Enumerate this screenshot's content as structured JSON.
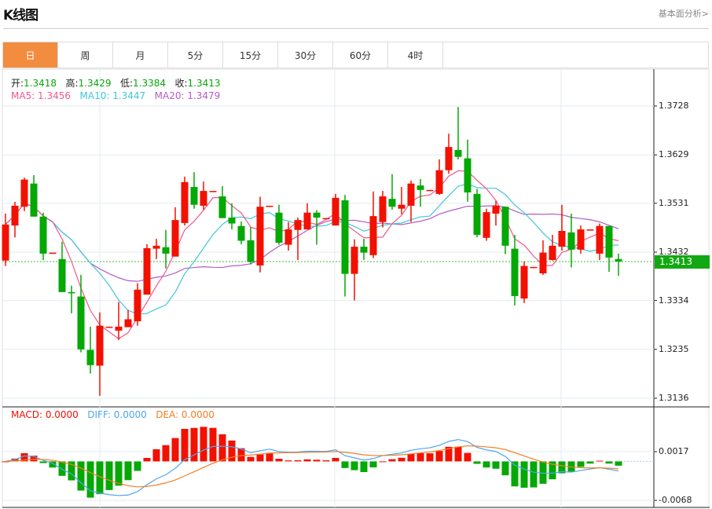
{
  "header": {
    "title": "K线图",
    "more_link": "基本面分析>"
  },
  "tabs": [
    {
      "label": "日",
      "active": true
    },
    {
      "label": "周"
    },
    {
      "label": "月"
    },
    {
      "label": "5分"
    },
    {
      "label": "15分"
    },
    {
      "label": "30分"
    },
    {
      "label": "60分"
    },
    {
      "label": "4时"
    }
  ],
  "ohlc_info": {
    "open_label": "开:",
    "open": "1.3418",
    "high_label": "高:",
    "high": "1.3429",
    "low_label": "低:",
    "low": "1.3384",
    "close_label": "收:",
    "close": "1.3413"
  },
  "ma_info": {
    "ma5": "MA5: 1.3456",
    "ma10": "MA10: 1.3447",
    "ma20": "MA20: 1.3479"
  },
  "macd_info": {
    "macd": "MACD: 0.0000",
    "diff": "DIFF: 0.0000",
    "dea": "DEA: 0.0000"
  },
  "current_price": "1.3413",
  "colors": {
    "up": "#f21100",
    "down": "#05a805",
    "ma5": "#f0588a",
    "ma10": "#3fc6dc",
    "ma20": "#b45cc8",
    "diff": "#4da6f0",
    "dea": "#f57e22",
    "accent": "#f28c3e"
  },
  "chart_data": {
    "type": "candlestick",
    "y_ticks": [
      "1.3728",
      "1.3629",
      "1.3531",
      "1.3432",
      "1.3334",
      "1.3235",
      "1.3136"
    ],
    "ylim": [
      1.3136,
      1.3728
    ],
    "macd_ticks": [
      "0.0017",
      "-0.0068"
    ],
    "macd_ylim": [
      -0.0068,
      0.0017
    ],
    "candles": [
      [
        1.3415,
        1.351,
        1.3404,
        1.3488
      ],
      [
        1.3486,
        1.3534,
        1.3462,
        1.3526
      ],
      [
        1.3524,
        1.3583,
        1.3515,
        1.3579
      ],
      [
        1.3571,
        1.3588,
        1.3504,
        1.3504
      ],
      [
        1.3504,
        1.3512,
        1.3416,
        1.3429
      ],
      [
        1.343,
        1.3431,
        1.343,
        1.3431
      ],
      [
        1.3418,
        1.3453,
        1.3351,
        1.3351
      ],
      [
        1.3351,
        1.3364,
        1.3308,
        1.335
      ],
      [
        1.3342,
        1.3386,
        1.3229,
        1.3235
      ],
      [
        1.3234,
        1.3281,
        1.3186,
        1.3203
      ],
      [
        1.3202,
        1.331,
        1.3141,
        1.3283
      ],
      [
        1.328,
        1.3281,
        1.328,
        1.3281
      ],
      [
        1.3273,
        1.3331,
        1.3254,
        1.3281
      ],
      [
        1.328,
        1.3315,
        1.328,
        1.3296
      ],
      [
        1.3292,
        1.3369,
        1.3283,
        1.3356
      ],
      [
        1.3346,
        1.3448,
        1.3346,
        1.344
      ],
      [
        1.3439,
        1.3459,
        1.3418,
        1.3445
      ],
      [
        1.3442,
        1.3477,
        1.3399,
        1.3429
      ],
      [
        1.3423,
        1.3523,
        1.3423,
        1.3497
      ],
      [
        1.3491,
        1.3585,
        1.3486,
        1.3574
      ],
      [
        1.3564,
        1.3594,
        1.352,
        1.3528
      ],
      [
        1.3526,
        1.3575,
        1.3518,
        1.3556
      ],
      [
        1.3555,
        1.3556,
        1.3555,
        1.3556
      ],
      [
        1.3545,
        1.3566,
        1.3501,
        1.3501
      ],
      [
        1.3502,
        1.3531,
        1.3478,
        1.349
      ],
      [
        1.3485,
        1.3494,
        1.3448,
        1.3455
      ],
      [
        1.3456,
        1.3483,
        1.3407,
        1.3412
      ],
      [
        1.3405,
        1.3544,
        1.3391,
        1.3524
      ],
      [
        1.3525,
        1.3526,
        1.3525,
        1.3526
      ],
      [
        1.3512,
        1.3528,
        1.3447,
        1.3451
      ],
      [
        1.3447,
        1.3493,
        1.3435,
        1.3478
      ],
      [
        1.3477,
        1.3502,
        1.3416,
        1.3497
      ],
      [
        1.3478,
        1.3531,
        1.3478,
        1.3512
      ],
      [
        1.3512,
        1.3517,
        1.3447,
        1.3502
      ],
      [
        1.35,
        1.3501,
        1.35,
        1.3501
      ],
      [
        1.3486,
        1.355,
        1.3486,
        1.3542
      ],
      [
        1.3537,
        1.3548,
        1.3342,
        1.3388
      ],
      [
        1.3388,
        1.3458,
        1.3334,
        1.3443
      ],
      [
        1.3443,
        1.3459,
        1.3416,
        1.3431
      ],
      [
        1.3426,
        1.3555,
        1.342,
        1.3505
      ],
      [
        1.3493,
        1.3556,
        1.3482,
        1.3545
      ],
      [
        1.354,
        1.359,
        1.3518,
        1.3524
      ],
      [
        1.352,
        1.3564,
        1.3509,
        1.3528
      ],
      [
        1.3526,
        1.3577,
        1.3493,
        1.3571
      ],
      [
        1.3567,
        1.358,
        1.3524,
        1.3558
      ],
      [
        1.3557,
        1.3558,
        1.3557,
        1.3558
      ],
      [
        1.355,
        1.362,
        1.3548,
        1.3598
      ],
      [
        1.3598,
        1.3672,
        1.3591,
        1.3645
      ],
      [
        1.3639,
        1.3726,
        1.362,
        1.3625
      ],
      [
        1.3622,
        1.366,
        1.3534,
        1.3553
      ],
      [
        1.355,
        1.356,
        1.3462,
        1.3467
      ],
      [
        1.3461,
        1.352,
        1.3455,
        1.3513
      ],
      [
        1.351,
        1.3536,
        1.3486,
        1.3526
      ],
      [
        1.3524,
        1.3524,
        1.3428,
        1.3445
      ],
      [
        1.3439,
        1.3467,
        1.3324,
        1.3343
      ],
      [
        1.3338,
        1.3413,
        1.3329,
        1.3404
      ],
      [
        1.3401,
        1.3402,
        1.3401,
        1.3402
      ],
      [
        1.3389,
        1.3456,
        1.3386,
        1.3431
      ],
      [
        1.3416,
        1.3467,
        1.3415,
        1.3445
      ],
      [
        1.3443,
        1.3528,
        1.3435,
        1.3475
      ],
      [
        1.3472,
        1.351,
        1.3401,
        1.3437
      ],
      [
        1.3437,
        1.3486,
        1.3429,
        1.3478
      ],
      [
        1.3477,
        1.3478,
        1.3477,
        1.3478
      ],
      [
        1.3429,
        1.349,
        1.3416,
        1.3485
      ],
      [
        1.3485,
        1.3485,
        1.3392,
        1.3421
      ],
      [
        1.3418,
        1.3429,
        1.3384,
        1.3413
      ]
    ]
  }
}
